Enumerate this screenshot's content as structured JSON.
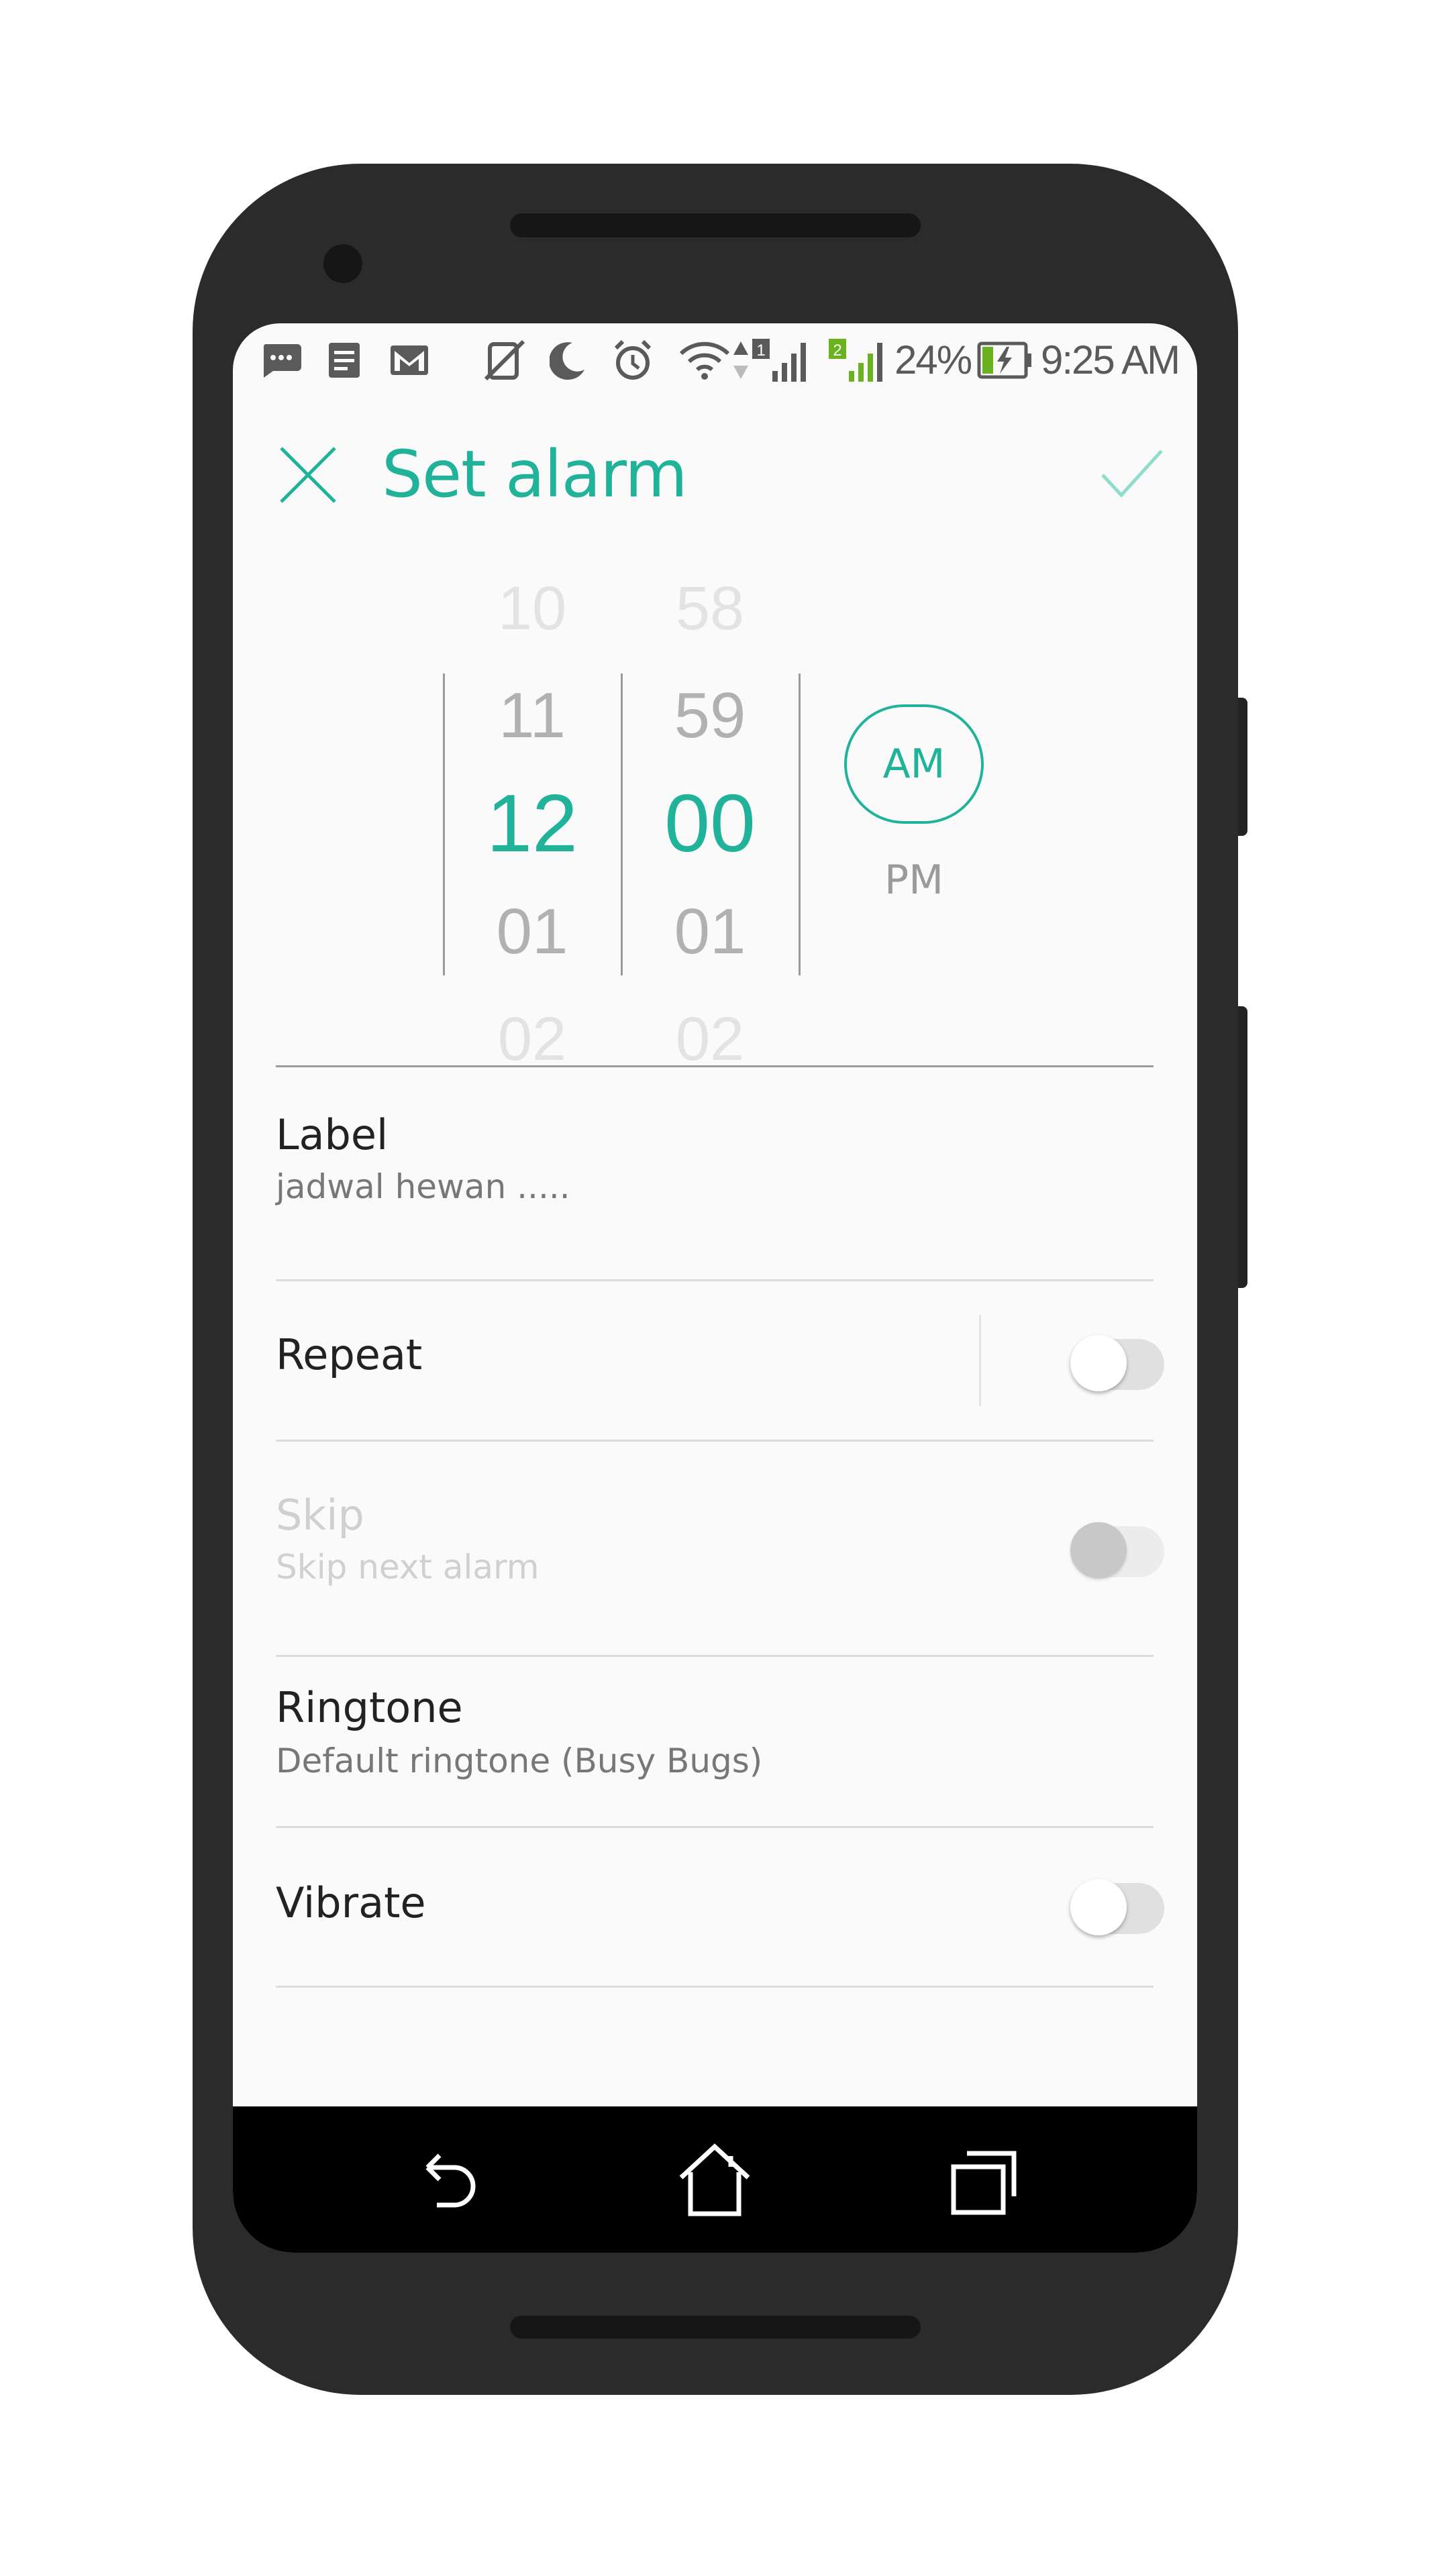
{
  "status_bar": {
    "battery": "24%",
    "time": "9:25 AM",
    "sim1_badge": "1",
    "sim2_badge": "2",
    "icons": [
      "message-icon",
      "notes-icon",
      "gmail-icon",
      "silent-mode-icon",
      "do-not-disturb-moon-icon",
      "alarm-clock-icon",
      "wifi-icon",
      "data-arrows-icon",
      "signal-icon",
      "signal-icon",
      "battery-charging-icon"
    ]
  },
  "header": {
    "title": "Set alarm",
    "close_icon": "close-icon",
    "confirm_icon": "check-icon"
  },
  "picker": {
    "hours": [
      "10",
      "11",
      "12",
      "01",
      "02"
    ],
    "minutes": [
      "58",
      "59",
      "00",
      "01",
      "02"
    ],
    "selected_hour": "12",
    "selected_minute": "00",
    "am_label": "AM",
    "pm_label": "PM",
    "selected_period": "AM"
  },
  "settings": {
    "label": {
      "title": "Label",
      "value": "jadwal hewan ....."
    },
    "repeat": {
      "title": "Repeat",
      "enabled": false
    },
    "skip": {
      "title": "Skip",
      "subtitle": "Skip next alarm",
      "enabled": false,
      "disabled": true
    },
    "ringtone": {
      "title": "Ringtone",
      "value": "Default ringtone (Busy Bugs)"
    },
    "vibrate": {
      "title": "Vibrate",
      "enabled": false
    }
  },
  "navbar": {
    "icons": [
      "back-icon",
      "home-icon",
      "recents-icon"
    ]
  },
  "colors": {
    "accent": "#20b39a",
    "background": "#fafafa",
    "frame": "#2b2b2b"
  }
}
